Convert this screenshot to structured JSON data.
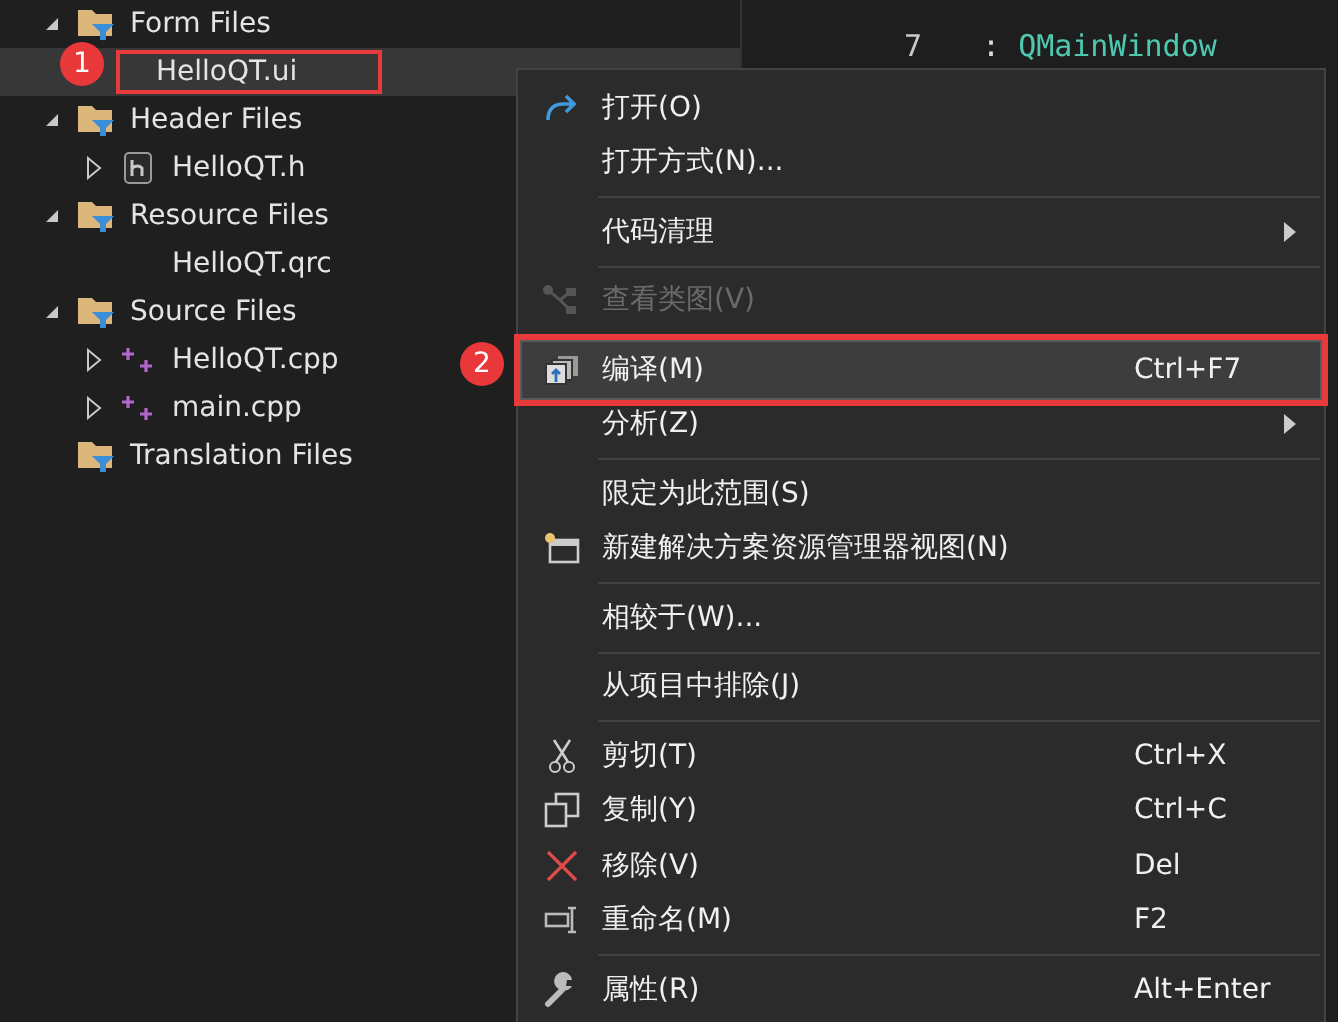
{
  "tree": [
    {
      "label": "Form Files",
      "kind": "filter-folder",
      "expanded": true,
      "selected": false,
      "children": [
        {
          "label": "HelloQT.ui",
          "kind": "none",
          "selected": true
        }
      ]
    },
    {
      "label": "Header Files",
      "kind": "filter-folder",
      "expanded": true,
      "selected": false,
      "children": [
        {
          "label": "HelloQT.h",
          "kind": "header",
          "expanded": false,
          "selected": false
        }
      ]
    },
    {
      "label": "Resource Files",
      "kind": "filter-folder",
      "expanded": true,
      "selected": false,
      "children": [
        {
          "label": "HelloQT.qrc",
          "kind": "none",
          "selected": false
        }
      ]
    },
    {
      "label": "Source Files",
      "kind": "filter-folder",
      "expanded": true,
      "selected": false,
      "children": [
        {
          "label": "HelloQT.cpp",
          "kind": "cpp",
          "expanded": false,
          "selected": false
        },
        {
          "label": "main.cpp",
          "kind": "cpp",
          "expanded": false,
          "selected": false
        }
      ]
    },
    {
      "label": "Translation Files",
      "kind": "filter-folder",
      "selected": false
    }
  ],
  "editor": {
    "line_numbers": [
      "7"
    ],
    "code": [
      {
        "punct": ": ",
        "type": "QMainWindow"
      }
    ]
  },
  "menu": [
    {
      "kind": "item",
      "label": "打开(O)",
      "submenu": false,
      "disabled": false,
      "selected": false
    },
    {
      "kind": "item",
      "label": "打开方式(N)...",
      "submenu": false,
      "disabled": false,
      "selected": false
    },
    {
      "kind": "separator"
    },
    {
      "kind": "item",
      "label": "代码清理",
      "submenu": true,
      "disabled": false,
      "selected": false
    },
    {
      "kind": "separator"
    },
    {
      "kind": "item",
      "label": "查看类图(V)",
      "submenu": false,
      "disabled": true,
      "selected": false
    },
    {
      "kind": "separator"
    },
    {
      "kind": "item",
      "label": "编译(M)",
      "shortcut": "Ctrl+F7",
      "submenu": false,
      "disabled": false,
      "selected": true
    },
    {
      "kind": "item",
      "label": "分析(Z)",
      "submenu": true,
      "disabled": false,
      "selected": false
    },
    {
      "kind": "separator"
    },
    {
      "kind": "item",
      "label": "限定为此范围(S)",
      "submenu": false,
      "disabled": false,
      "selected": false
    },
    {
      "kind": "item",
      "label": "新建解决方案资源管理器视图(N)",
      "submenu": false,
      "disabled": false,
      "selected": false
    },
    {
      "kind": "separator"
    },
    {
      "kind": "item",
      "label": "相较于(W)...",
      "submenu": false,
      "disabled": false,
      "selected": false
    },
    {
      "kind": "separator"
    },
    {
      "kind": "item",
      "label": "从项目中排除(J)",
      "submenu": false,
      "disabled": false,
      "selected": false
    },
    {
      "kind": "separator"
    },
    {
      "kind": "item",
      "label": "剪切(T)",
      "shortcut": "Ctrl+X",
      "submenu": false,
      "disabled": false,
      "selected": false
    },
    {
      "kind": "item",
      "label": "复制(Y)",
      "shortcut": "Ctrl+C",
      "submenu": false,
      "disabled": false,
      "selected": false
    },
    {
      "kind": "item",
      "label": "移除(V)",
      "shortcut": "Del",
      "submenu": false,
      "disabled": false,
      "selected": false
    },
    {
      "kind": "item",
      "label": "重命名(M)",
      "shortcut": "F2",
      "submenu": false,
      "disabled": false,
      "selected": false
    },
    {
      "kind": "separator"
    },
    {
      "kind": "item",
      "label": "属性(R)",
      "shortcut": "Alt+Enter",
      "submenu": false,
      "disabled": false,
      "selected": false
    }
  ],
  "annotations": [
    {
      "label": "1"
    },
    {
      "label": "2"
    }
  ]
}
